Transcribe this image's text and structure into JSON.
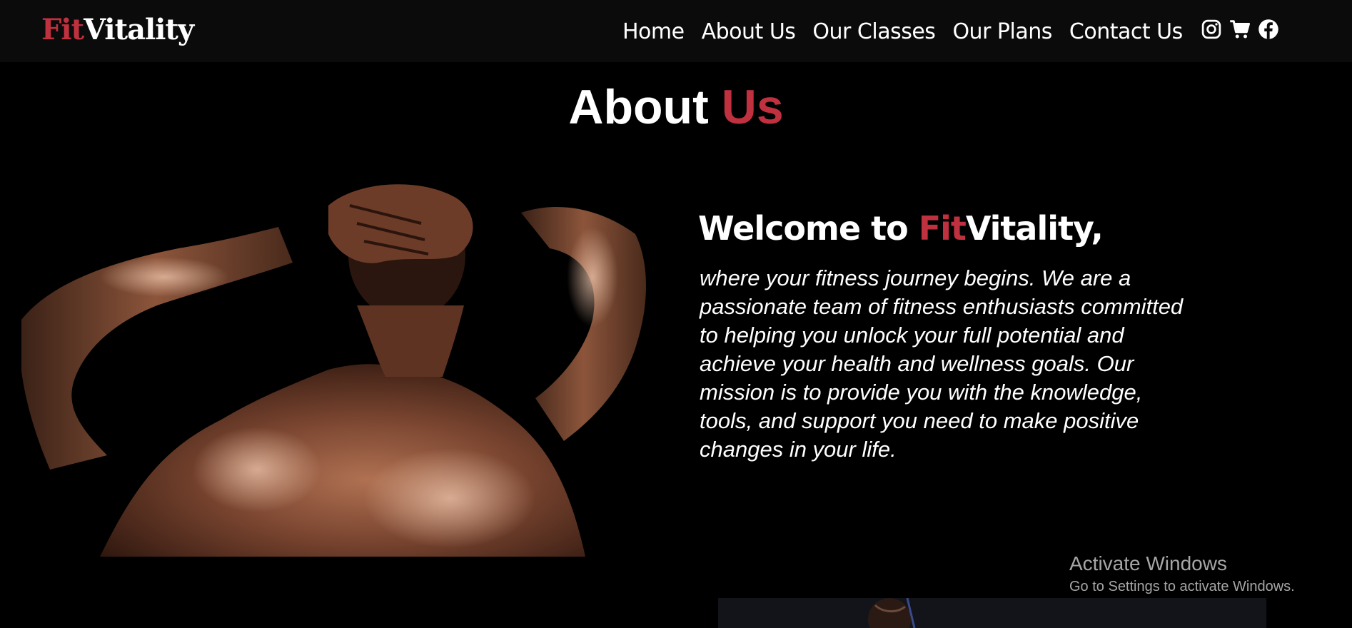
{
  "brand": {
    "fit": "Fit",
    "vitality": "Vitality",
    "accent_color": "#c0313f"
  },
  "nav": {
    "links": [
      "Home",
      "About Us",
      "Our Classes",
      "Our Plans",
      "Contact Us"
    ],
    "icons": [
      "instagram-icon",
      "cart-icon",
      "facebook-icon"
    ]
  },
  "about": {
    "title_white": "About",
    "title_accent": "Us",
    "welcome_prefix": "Welcome to ",
    "welcome_fit": "Fit",
    "welcome_suffix": "Vitality,",
    "body": "where your fitness journey begins. We are a passionate team of fitness enthusiasts committed to helping you unlock your full potential and achieve your health and wellness goals. Our mission is to provide you with the knowledge, tools, and support you need to make positive changes in your life."
  },
  "windows_watermark": {
    "title": "Activate Windows",
    "subtitle": "Go to Settings to activate Windows."
  }
}
